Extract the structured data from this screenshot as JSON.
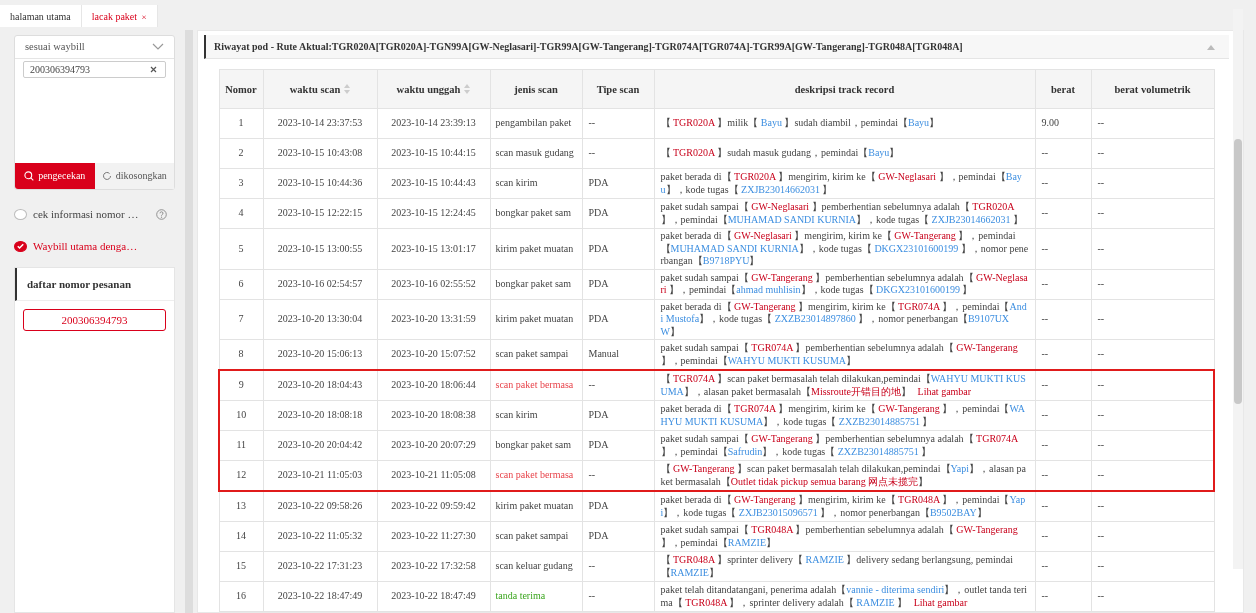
{
  "tabs": [
    {
      "label": "halaman utama",
      "selected": false
    },
    {
      "label": "lacak paket",
      "selected": true,
      "close_label": "×"
    }
  ],
  "search": {
    "mode": "sesuai waybill",
    "value": "200306394793"
  },
  "buttons": [
    {
      "label": "pengecekan",
      "kind": "primary"
    },
    {
      "label": "dikosongkan",
      "kind": "reset"
    }
  ],
  "options": [
    {
      "label": "cek informasi nomor …",
      "checked": false,
      "help": true
    },
    {
      "label": "Waybill utama denga…",
      "checked": true,
      "help": false
    }
  ],
  "order_list": {
    "title": "daftar nomor pesanan",
    "items": [
      {
        "value": "200306394793",
        "selected": true
      }
    ]
  },
  "panel": {
    "title": "Riwayat pod - Rute Aktual:TGR020A[TGR020A]-TGN99A[GW-Neglasari]-TGR99A[GW-Tangerang]-TGR074A[TGR074A]-TGR99A[GW-Tangerang]-TGR048A[TGR048A]",
    "expanded": true
  },
  "table": {
    "columns": [
      {
        "label": "Nomor",
        "sortable": false
      },
      {
        "label": "waktu scan",
        "sortable": true
      },
      {
        "label": "waktu unggah",
        "sortable": true
      },
      {
        "label": "jenis scan",
        "sortable": false
      },
      {
        "label": "Tipe scan",
        "sortable": false
      },
      {
        "label": "deskripsi track record",
        "sortable": false
      },
      {
        "label": "berat",
        "sortable": false
      },
      {
        "label": "berat volumetrik",
        "sortable": false
      }
    ],
    "rows": [
      {
        "no": "1",
        "scan_time": "2023-10-14 23:37:53",
        "upload_time": "2023-10-14 23:39:13",
        "scan_type": {
          "text": "pengambilan paket",
          "kind": "normal"
        },
        "tipe": "--",
        "description": [
          {
            "text": "【 ",
            "kind": "plain"
          },
          {
            "text": "TGR020A",
            "kind": "place"
          },
          {
            "text": " 】milik【 ",
            "kind": "plain"
          },
          {
            "text": "Bayu",
            "kind": "person"
          },
          {
            "text": " 】sudah diambil，pemindai【",
            "kind": "plain"
          },
          {
            "text": "Bayu",
            "kind": "person"
          },
          {
            "text": "】",
            "kind": "plain"
          }
        ],
        "weight": "9.00",
        "volume": "--",
        "highlighted": false
      },
      {
        "no": "2",
        "scan_time": "2023-10-15 10:43:08",
        "upload_time": "2023-10-15 10:44:15",
        "scan_type": {
          "text": "scan masuk gudang",
          "kind": "normal"
        },
        "tipe": "--",
        "description": [
          {
            "text": "【 ",
            "kind": "plain"
          },
          {
            "text": "TGR020A",
            "kind": "place"
          },
          {
            "text": " 】sudah masuk gudang，pemindai【",
            "kind": "plain"
          },
          {
            "text": "Bayu",
            "kind": "person"
          },
          {
            "text": "】",
            "kind": "plain"
          }
        ],
        "weight": "--",
        "volume": "--",
        "highlighted": false
      },
      {
        "no": "3",
        "scan_time": "2023-10-15 10:44:36",
        "upload_time": "2023-10-15 10:44:43",
        "scan_type": {
          "text": "scan kirim",
          "kind": "normal"
        },
        "tipe": "PDA",
        "description": [
          {
            "text": "paket berada di【 ",
            "kind": "plain"
          },
          {
            "text": "TGR020A",
            "kind": "place"
          },
          {
            "text": " 】mengirim, kirim ke【 ",
            "kind": "plain"
          },
          {
            "text": "GW-Neglasari",
            "kind": "place"
          },
          {
            "text": " 】，pemindai【",
            "kind": "plain"
          },
          {
            "text": "Bayu",
            "kind": "person"
          },
          {
            "text": "】，kode tugas【 ",
            "kind": "plain"
          },
          {
            "text": "ZXJB23014662031",
            "kind": "person"
          },
          {
            "text": " 】",
            "kind": "plain"
          }
        ],
        "weight": "--",
        "volume": "--",
        "highlighted": false
      },
      {
        "no": "4",
        "scan_time": "2023-10-15 12:22:15",
        "upload_time": "2023-10-15 12:24:45",
        "scan_type": {
          "text": "bongkar paket sam",
          "kind": "normal"
        },
        "tipe": "PDA",
        "description": [
          {
            "text": "paket sudah sampai【 ",
            "kind": "plain"
          },
          {
            "text": "GW-Neglasari",
            "kind": "place"
          },
          {
            "text": " 】pemberhentian sebelumnya adalah【 ",
            "kind": "plain"
          },
          {
            "text": "TGR020A",
            "kind": "place"
          },
          {
            "text": " 】，pemindai【",
            "kind": "plain"
          },
          {
            "text": "MUHAMAD SANDI KURNIA",
            "kind": "person"
          },
          {
            "text": "】，kode tugas【 ",
            "kind": "plain"
          },
          {
            "text": "ZXJB23014662031",
            "kind": "person"
          },
          {
            "text": " 】",
            "kind": "plain"
          }
        ],
        "weight": "--",
        "volume": "--",
        "highlighted": false
      },
      {
        "no": "5",
        "scan_time": "2023-10-15 13:00:55",
        "upload_time": "2023-10-15 13:01:17",
        "scan_type": {
          "text": "kirim paket muatan",
          "kind": "normal"
        },
        "tipe": "PDA",
        "description": [
          {
            "text": "paket berada di【 ",
            "kind": "plain"
          },
          {
            "text": "GW-Neglasari",
            "kind": "place"
          },
          {
            "text": " 】mengirim, kirim ke【 ",
            "kind": "plain"
          },
          {
            "text": "GW-Tangerang",
            "kind": "place"
          },
          {
            "text": " 】，pemindai【",
            "kind": "plain"
          },
          {
            "text": "MUHAMAD SANDI KURNIA",
            "kind": "person"
          },
          {
            "text": "】，kode tugas【 ",
            "kind": "plain"
          },
          {
            "text": "DKGX23101600199",
            "kind": "person"
          },
          {
            "text": " 】，nomor penerbangan【",
            "kind": "plain"
          },
          {
            "text": "B9718PYU",
            "kind": "person"
          },
          {
            "text": "】",
            "kind": "plain"
          }
        ],
        "weight": "--",
        "volume": "--",
        "highlighted": false
      },
      {
        "no": "6",
        "scan_time": "2023-10-16 02:54:57",
        "upload_time": "2023-10-16 02:55:52",
        "scan_type": {
          "text": "bongkar paket sam",
          "kind": "normal"
        },
        "tipe": "PDA",
        "description": [
          {
            "text": "paket sudah sampai【 ",
            "kind": "plain"
          },
          {
            "text": "GW-Tangerang",
            "kind": "place"
          },
          {
            "text": " 】pemberhentian sebelumnya adalah【 ",
            "kind": "plain"
          },
          {
            "text": "GW-Neglasari",
            "kind": "place"
          },
          {
            "text": " 】，pemindai【",
            "kind": "plain"
          },
          {
            "text": "ahmad muhlisin",
            "kind": "person"
          },
          {
            "text": "】，kode tugas【 ",
            "kind": "plain"
          },
          {
            "text": "DKGX23101600199",
            "kind": "person"
          },
          {
            "text": " 】",
            "kind": "plain"
          }
        ],
        "weight": "--",
        "volume": "--",
        "highlighted": false
      },
      {
        "no": "7",
        "scan_time": "2023-10-20 13:30:04",
        "upload_time": "2023-10-20 13:31:59",
        "scan_type": {
          "text": "kirim paket muatan",
          "kind": "normal"
        },
        "tipe": "PDA",
        "description": [
          {
            "text": "paket berada di【 ",
            "kind": "plain"
          },
          {
            "text": "GW-Tangerang",
            "kind": "place"
          },
          {
            "text": " 】mengirim, kirim ke【 ",
            "kind": "plain"
          },
          {
            "text": "TGR074A",
            "kind": "place"
          },
          {
            "text": " 】，pemindai【",
            "kind": "plain"
          },
          {
            "text": "Andi Mustofa",
            "kind": "person"
          },
          {
            "text": "】，kode tugas【 ",
            "kind": "plain"
          },
          {
            "text": "ZXZB23014897860",
            "kind": "person"
          },
          {
            "text": " 】，nomor penerbangan【",
            "kind": "plain"
          },
          {
            "text": "B9107UXW",
            "kind": "person"
          },
          {
            "text": "】",
            "kind": "plain"
          }
        ],
        "weight": "--",
        "volume": "--",
        "highlighted": false
      },
      {
        "no": "8",
        "scan_time": "2023-10-20 15:06:13",
        "upload_time": "2023-10-20 15:07:52",
        "scan_type": {
          "text": "scan paket sampai",
          "kind": "normal"
        },
        "tipe": "Manual",
        "description": [
          {
            "text": "paket sudah sampai【 ",
            "kind": "plain"
          },
          {
            "text": "TGR074A",
            "kind": "place"
          },
          {
            "text": " 】pemberhentian sebelumnya adalah【 ",
            "kind": "plain"
          },
          {
            "text": "GW-Tangerang",
            "kind": "place"
          },
          {
            "text": " 】，pemindai【",
            "kind": "plain"
          },
          {
            "text": "WAHYU MUKTI KUSUMA",
            "kind": "person"
          },
          {
            "text": "】",
            "kind": "plain"
          }
        ],
        "weight": "--",
        "volume": "--",
        "highlighted": false
      },
      {
        "no": "9",
        "scan_time": "2023-10-20 18:04:43",
        "upload_time": "2023-10-20 18:06:44",
        "scan_type": {
          "text": "scan paket bermasa",
          "kind": "problem"
        },
        "tipe": "--",
        "description": [
          {
            "text": "【 ",
            "kind": "plain"
          },
          {
            "text": "TGR074A",
            "kind": "place"
          },
          {
            "text": " 】scan paket bermasalah telah dilakukan,pemindai【",
            "kind": "plain"
          },
          {
            "text": "WAHYU MUKTI KUSUMA",
            "kind": "person"
          },
          {
            "text": "】，alasan paket bermasalah【",
            "kind": "plain"
          },
          {
            "text": "Missroute开错目的地",
            "kind": "place"
          },
          {
            "text": "】 ",
            "kind": "plain"
          },
          {
            "text": "Lihat gambar",
            "kind": "link"
          }
        ],
        "weight": "--",
        "volume": "--",
        "highlighted": true
      },
      {
        "no": "10",
        "scan_time": "2023-10-20 18:08:18",
        "upload_time": "2023-10-20 18:08:38",
        "scan_type": {
          "text": "scan kirim",
          "kind": "normal"
        },
        "tipe": "PDA",
        "description": [
          {
            "text": "paket berada di【 ",
            "kind": "plain"
          },
          {
            "text": "TGR074A",
            "kind": "place"
          },
          {
            "text": " 】mengirim, kirim ke【 ",
            "kind": "plain"
          },
          {
            "text": "GW-Tangerang",
            "kind": "place"
          },
          {
            "text": " 】，pemindai【",
            "kind": "plain"
          },
          {
            "text": "WAHYU MUKTI KUSUMA",
            "kind": "person"
          },
          {
            "text": "】，kode tugas【 ",
            "kind": "plain"
          },
          {
            "text": "ZXZB23014885751",
            "kind": "person"
          },
          {
            "text": " 】",
            "kind": "plain"
          }
        ],
        "weight": "--",
        "volume": "--",
        "highlighted": true
      },
      {
        "no": "11",
        "scan_time": "2023-10-20 20:04:42",
        "upload_time": "2023-10-20 20:07:29",
        "scan_type": {
          "text": "bongkar paket sam",
          "kind": "normal"
        },
        "tipe": "PDA",
        "description": [
          {
            "text": "paket sudah sampai【 ",
            "kind": "plain"
          },
          {
            "text": "GW-Tangerang",
            "kind": "place"
          },
          {
            "text": " 】pemberhentian sebelumnya adalah【 ",
            "kind": "plain"
          },
          {
            "text": "TGR074A",
            "kind": "place"
          },
          {
            "text": " 】，pemindai【",
            "kind": "plain"
          },
          {
            "text": "Safrudin",
            "kind": "person"
          },
          {
            "text": "】，kode tugas【 ",
            "kind": "plain"
          },
          {
            "text": "ZXZB23014885751",
            "kind": "person"
          },
          {
            "text": " 】",
            "kind": "plain"
          }
        ],
        "weight": "--",
        "volume": "--",
        "highlighted": true
      },
      {
        "no": "12",
        "scan_time": "2023-10-21 11:05:03",
        "upload_time": "2023-10-21 11:05:08",
        "scan_type": {
          "text": "scan paket bermasa",
          "kind": "problem"
        },
        "tipe": "--",
        "description": [
          {
            "text": "【 ",
            "kind": "plain"
          },
          {
            "text": "GW-Tangerang",
            "kind": "place"
          },
          {
            "text": " 】scan paket bermasalah telah dilakukan,pemindai【",
            "kind": "plain"
          },
          {
            "text": "Yapi",
            "kind": "person"
          },
          {
            "text": "】，alasan paket bermasalah【",
            "kind": "plain"
          },
          {
            "text": "Outlet tidak pickup semua barang 网点未揽完",
            "kind": "place"
          },
          {
            "text": "】",
            "kind": "plain"
          }
        ],
        "weight": "--",
        "volume": "--",
        "highlighted": true
      },
      {
        "no": "13",
        "scan_time": "2023-10-22 09:58:26",
        "upload_time": "2023-10-22 09:59:42",
        "scan_type": {
          "text": "kirim paket muatan",
          "kind": "normal"
        },
        "tipe": "PDA",
        "description": [
          {
            "text": "paket berada di【 ",
            "kind": "plain"
          },
          {
            "text": "GW-Tangerang",
            "kind": "place"
          },
          {
            "text": " 】mengirim, kirim ke【 ",
            "kind": "plain"
          },
          {
            "text": "TGR048A",
            "kind": "place"
          },
          {
            "text": " 】，pemindai【",
            "kind": "plain"
          },
          {
            "text": "Yapi",
            "kind": "person"
          },
          {
            "text": "】，kode tugas【 ",
            "kind": "plain"
          },
          {
            "text": "ZXJB23015096571",
            "kind": "person"
          },
          {
            "text": " 】，nomor penerbangan【",
            "kind": "plain"
          },
          {
            "text": "B9502BAY",
            "kind": "person"
          },
          {
            "text": "】",
            "kind": "plain"
          }
        ],
        "weight": "--",
        "volume": "--",
        "highlighted": false
      },
      {
        "no": "14",
        "scan_time": "2023-10-22 11:05:32",
        "upload_time": "2023-10-22 11:27:30",
        "scan_type": {
          "text": "scan paket sampai",
          "kind": "normal"
        },
        "tipe": "PDA",
        "description": [
          {
            "text": "paket sudah sampai【 ",
            "kind": "plain"
          },
          {
            "text": "TGR048A",
            "kind": "place"
          },
          {
            "text": " 】pemberhentian sebelumnya adalah【 ",
            "kind": "plain"
          },
          {
            "text": "GW-Tangerang",
            "kind": "place"
          },
          {
            "text": " 】，pemindai【",
            "kind": "plain"
          },
          {
            "text": "RAMZIE",
            "kind": "person"
          },
          {
            "text": "】",
            "kind": "plain"
          }
        ],
        "weight": "--",
        "volume": "--",
        "highlighted": false
      },
      {
        "no": "15",
        "scan_time": "2023-10-22 17:31:23",
        "upload_time": "2023-10-22 17:32:58",
        "scan_type": {
          "text": "scan keluar gudang",
          "kind": "normal"
        },
        "tipe": "--",
        "description": [
          {
            "text": "【 ",
            "kind": "plain"
          },
          {
            "text": "TGR048A",
            "kind": "place"
          },
          {
            "text": " 】sprinter delivery【 ",
            "kind": "plain"
          },
          {
            "text": "RAMZIE",
            "kind": "person"
          },
          {
            "text": " 】delivery sedang berlangsung, pemindai【",
            "kind": "plain"
          },
          {
            "text": "RAMZIE",
            "kind": "person"
          },
          {
            "text": "】",
            "kind": "plain"
          }
        ],
        "weight": "--",
        "volume": "--",
        "highlighted": false
      },
      {
        "no": "16",
        "scan_time": "2023-10-22 18:47:49",
        "upload_time": "2023-10-22 18:47:49",
        "scan_type": {
          "text": "tanda terima",
          "kind": "signed"
        },
        "tipe": "--",
        "description": [
          {
            "text": "paket telah ditandatangani, penerima adalah【",
            "kind": "plain"
          },
          {
            "text": "vannie - diterima sendiri",
            "kind": "person"
          },
          {
            "text": "】，outlet tanda terima【 ",
            "kind": "plain"
          },
          {
            "text": "TGR048A",
            "kind": "place"
          },
          {
            "text": " 】，sprinter delivery adalah【 ",
            "kind": "plain"
          },
          {
            "text": "RAMZIE",
            "kind": "person"
          },
          {
            "text": " 】 ",
            "kind": "plain"
          },
          {
            "text": "Lihat gambar",
            "kind": "link"
          }
        ],
        "weight": "--",
        "volume": "--",
        "highlighted": false
      }
    ]
  }
}
